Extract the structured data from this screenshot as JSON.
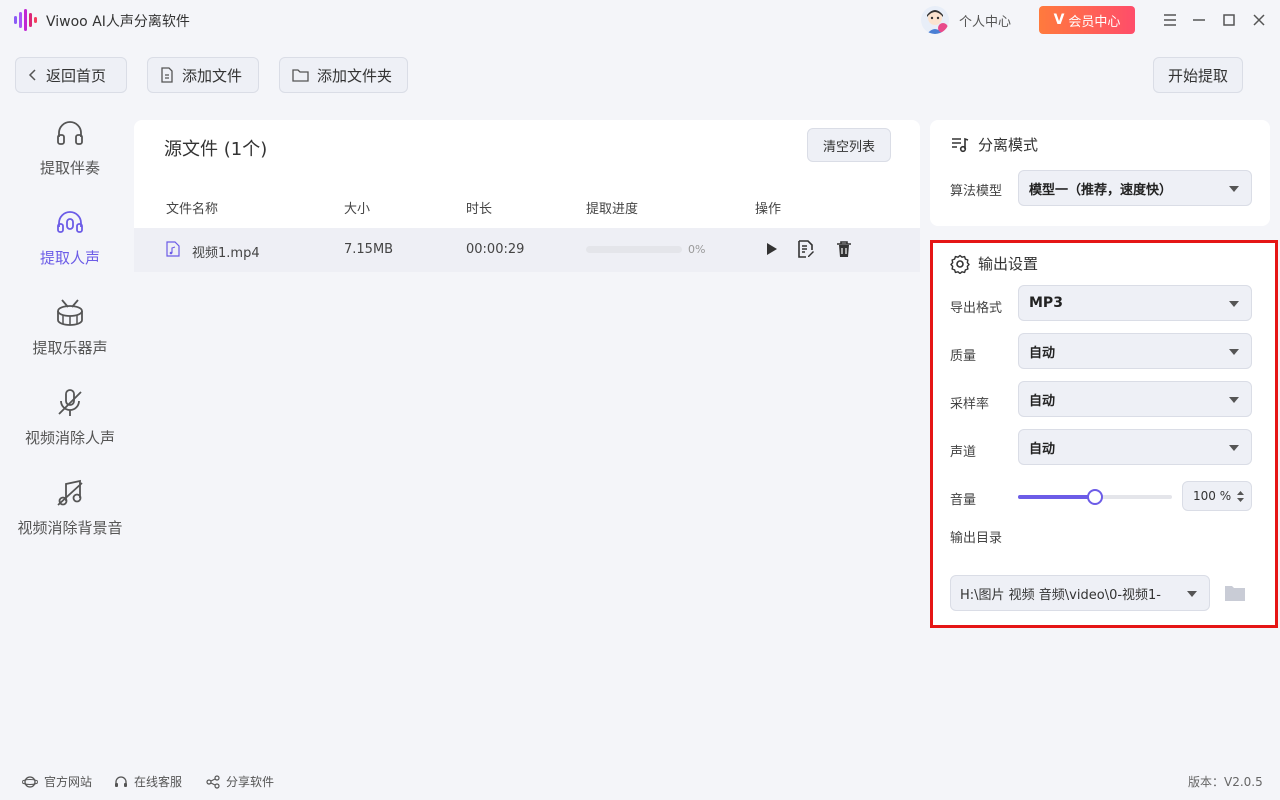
{
  "app": {
    "title": "Viwoo AI人声分离软件",
    "user_center": "个人中心",
    "vip_label": "会员中心",
    "accent": "#6c5ce7"
  },
  "toolbar": {
    "back": "返回首页",
    "add_file": "添加文件",
    "add_folder": "添加文件夹",
    "start": "开始提取"
  },
  "sidebar": {
    "items": [
      {
        "label": "提取伴奏",
        "icon": "headphones-icon",
        "active": false
      },
      {
        "label": "提取人声",
        "icon": "headset-mic-icon",
        "active": true
      },
      {
        "label": "提取乐器声",
        "icon": "drum-icon",
        "active": false
      },
      {
        "label": "视频消除人声",
        "icon": "mic-off-icon",
        "active": false
      },
      {
        "label": "视频消除背景音",
        "icon": "music-off-icon",
        "active": false
      }
    ]
  },
  "files": {
    "title": "源文件 (1个)",
    "clear": "清空列表",
    "columns": [
      "文件名称",
      "大小",
      "时长",
      "提取进度",
      "操作"
    ],
    "rows": [
      {
        "name": "视频1.mp4",
        "size": "7.15MB",
        "duration": "00:00:29",
        "progress": 0,
        "progress_text": "0%"
      }
    ]
  },
  "mode": {
    "title": "分离模式",
    "model_label": "算法模型",
    "model_value": "模型一（推荐，速度快）"
  },
  "output": {
    "title": "输出设置",
    "format_label": "导出格式",
    "format_value": "MP3",
    "quality_label": "质量",
    "quality_value": "自动",
    "rate_label": "采样率",
    "rate_value": "自动",
    "channel_label": "声道",
    "channel_value": "自动",
    "volume_label": "音量",
    "volume_value": "100 %",
    "volume_level": 0.5,
    "dir_label": "输出目录",
    "dir_value": "H:\\图片 视频 音频\\video\\0-视频1-"
  },
  "footer": {
    "site": "官方网站",
    "service": "在线客服",
    "share": "分享软件",
    "version": "版本：V2.0.5"
  }
}
